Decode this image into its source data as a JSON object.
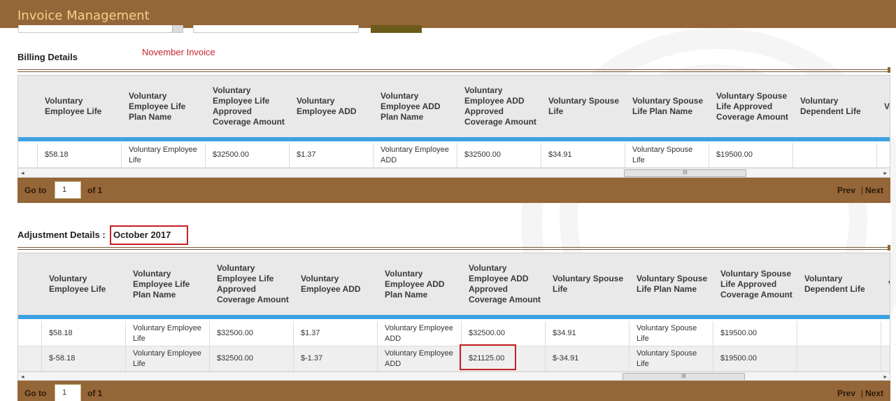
{
  "app": {
    "title": "Invoice Management"
  },
  "billing": {
    "label": "Billing Details",
    "note": "November Invoice",
    "columns": [
      "Voluntary Employee Life",
      "Voluntary Employee Life Plan Name",
      "Voluntary Employee Life Approved Coverage Amount",
      "Voluntary Employee ADD",
      "Voluntary Employee ADD Plan Name",
      "Voluntary Employee ADD Approved Coverage Amount",
      "Voluntary Spouse Life",
      "Voluntary Spouse Life Plan Name",
      "Voluntary Spouse Life Approved Coverage Amount",
      "Voluntary Dependent Life",
      "Vo De Pl"
    ],
    "rows": [
      [
        "$58.18",
        "Voluntary Employee Life",
        "$32500.00",
        "$1.37",
        "Voluntary Employee ADD",
        "$32500.00",
        "$34.91",
        "Voluntary Spouse Life",
        "$19500.00",
        "",
        ""
      ]
    ],
    "pager": {
      "goto": "Go to",
      "page": "1",
      "of": "of 1",
      "prev": "Prev",
      "sep": "|",
      "next": "Next"
    }
  },
  "adjustment": {
    "label": "Adjustment Details :",
    "month": "October 2017",
    "columns": [
      "Voluntary Employee Life",
      "Voluntary Employee Life Plan Name",
      "Voluntary Employee Life Approved Coverage Amount",
      "Voluntary Employee ADD",
      "Voluntary Employee ADD Plan Name",
      "Voluntary Employee ADD Approved Coverage Amount",
      "Voluntary Spouse Life",
      "Voluntary Spouse Life Plan Name",
      "Voluntary Spouse Life Approved Coverage Amount",
      "Voluntary Dependent Life",
      "V E P"
    ],
    "rows": [
      [
        "$58.18",
        "Voluntary Employee Life",
        "$32500.00",
        "$1.37",
        "Voluntary Employee ADD",
        "$32500.00",
        "$34.91",
        "Voluntary Spouse Life",
        "$19500.00",
        "",
        ""
      ],
      [
        "$-58.18",
        "Voluntary Employee Life",
        "$32500.00",
        "$-1.37",
        "Voluntary Employee ADD",
        "$21125.00",
        "$-34.91",
        "Voluntary Spouse Life",
        "$19500.00",
        "",
        ""
      ]
    ],
    "pager": {
      "goto": "Go to",
      "page": "1",
      "of": "of 1",
      "prev": "Prev",
      "sep": "|",
      "next": "Next"
    }
  },
  "scrollbar": {
    "thumb": "III",
    "left": "◂",
    "right": "▸"
  },
  "colors": {
    "header": "#956638",
    "title": "#f3d28d",
    "accent_blue": "#3ea1e1",
    "highlight_red": "#c71f24"
  }
}
